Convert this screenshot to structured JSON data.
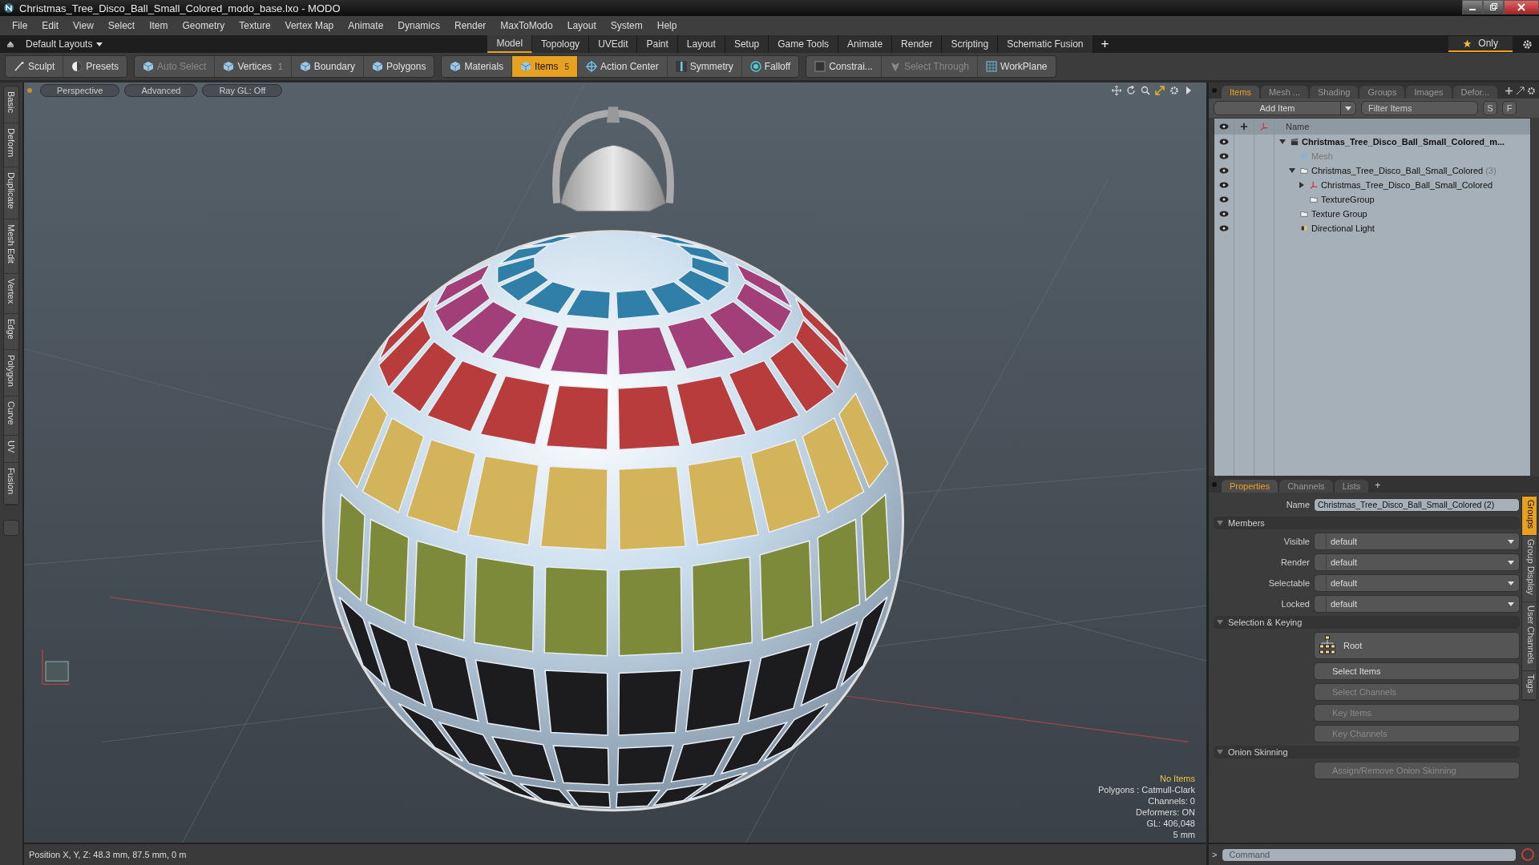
{
  "window": {
    "title": "Christmas_Tree_Disco_Ball_Small_Colored_modo_base.lxo - MODO"
  },
  "menu": [
    "File",
    "Edit",
    "View",
    "Select",
    "Item",
    "Geometry",
    "Texture",
    "Vertex Map",
    "Animate",
    "Dynamics",
    "Render",
    "MaxToModo",
    "Layout",
    "System",
    "Help"
  ],
  "layout_bar": {
    "layouts": "Default Layouts",
    "tabs": [
      {
        "label": "Model",
        "selected": true
      },
      {
        "label": "Topology",
        "selected": false
      },
      {
        "label": "UVEdit",
        "selected": false
      },
      {
        "label": "Paint",
        "selected": false
      },
      {
        "label": "Layout",
        "selected": false
      },
      {
        "label": "Setup",
        "selected": false
      },
      {
        "label": "Game Tools",
        "selected": false
      },
      {
        "label": "Animate",
        "selected": false
      },
      {
        "label": "Render",
        "selected": false
      },
      {
        "label": "Scripting",
        "selected": false
      },
      {
        "label": "Schematic Fusion",
        "selected": false
      }
    ],
    "add": "+",
    "only": "Only"
  },
  "toolbar": {
    "groups": [
      [
        {
          "label": "Sculpt",
          "selected": false,
          "disabled": false
        },
        {
          "label": "Presets",
          "selected": false,
          "disabled": false
        }
      ],
      [
        {
          "label": "Auto Select",
          "selected": false,
          "disabled": true
        },
        {
          "label": "Vertices",
          "selected": false,
          "disabled": false,
          "badge": "1"
        },
        {
          "label": "Boundary",
          "selected": false,
          "disabled": false
        },
        {
          "label": "Polygons",
          "selected": false,
          "disabled": false
        }
      ],
      [
        {
          "label": "Materials",
          "selected": false,
          "disabled": false
        },
        {
          "label": "Items",
          "selected": true,
          "disabled": false,
          "badge": "5"
        },
        {
          "label": "Action Center",
          "selected": false,
          "disabled": false
        },
        {
          "label": "Symmetry",
          "selected": false,
          "disabled": false
        },
        {
          "label": "Falloff",
          "selected": false,
          "disabled": false
        }
      ],
      [
        {
          "label": "Constrai...",
          "selected": false,
          "disabled": false
        },
        {
          "label": "Select Through",
          "selected": false,
          "disabled": true
        },
        {
          "label": "WorkPlane",
          "selected": false,
          "disabled": false
        }
      ]
    ]
  },
  "left_tabs": [
    "Basic",
    "Deform",
    "Duplicate",
    "Mesh Edit",
    "Vertex",
    "Edge",
    "Polygon",
    "Curve",
    "UV",
    "Fusion"
  ],
  "viewport": {
    "tabs": [
      "Perspective",
      "Advanced",
      "Ray GL: Off"
    ],
    "info_title": "No Items",
    "info_lines": [
      "Polygons : Catmull-Clark",
      "Channels: 0",
      "Deformers: ON",
      "GL: 406,048",
      "5 mm"
    ]
  },
  "status_bar": "Position X, Y, Z:  48.3 mm, 87.5 mm, 0 m",
  "items_panel": {
    "tabs": [
      {
        "label": "Items",
        "selected": true
      },
      {
        "label": "Mesh ...",
        "selected": false
      },
      {
        "label": "Shading",
        "selected": false
      },
      {
        "label": "Groups",
        "selected": false
      },
      {
        "label": "Images",
        "selected": false
      },
      {
        "label": "Defor...",
        "selected": false
      }
    ],
    "add_item": "Add Item",
    "filter_placeholder": "Filter Items",
    "filter_buttons": [
      "S",
      "F"
    ],
    "name_column": "Name",
    "tree": [
      {
        "label": "Christmas_Tree_Disco_Ball_Small_Colored_m...",
        "kind": "scene",
        "expanded": true,
        "children": [
          {
            "label": "Mesh",
            "kind": "mesh",
            "disabled": true
          },
          {
            "label": "Christmas_Tree_Disco_Ball_Small_Colored",
            "count": "(3)",
            "kind": "group",
            "expanded": true,
            "children": [
              {
                "label": "Christmas_Tree_Disco_Ball_Small_Colored",
                "kind": "locator",
                "expanded": false
              },
              {
                "label": "TextureGroup",
                "kind": "group"
              }
            ]
          },
          {
            "label": "Texture Group",
            "kind": "group"
          },
          {
            "label": "Directional Light",
            "kind": "light"
          }
        ]
      }
    ]
  },
  "properties": {
    "tabs": [
      {
        "label": "Properties",
        "selected": true
      },
      {
        "label": "Channels",
        "selected": false
      },
      {
        "label": "Lists",
        "selected": false
      }
    ],
    "add": "+",
    "name_label": "Name",
    "name_value": "Christmas_Tree_Disco_Ball_Small_Colored (2)",
    "sections": [
      {
        "title": "Members",
        "rows": [
          {
            "kind": "dropdown",
            "label": "Visible",
            "value": "default"
          },
          {
            "kind": "dropdown",
            "label": "Render",
            "value": "default"
          },
          {
            "kind": "dropdown",
            "label": "Selectable",
            "value": "default"
          },
          {
            "kind": "dropdown",
            "label": "Locked",
            "value": "default"
          }
        ]
      },
      {
        "title": "Selection & Keying",
        "rows": [
          {
            "kind": "root",
            "label": "Root"
          },
          {
            "kind": "button",
            "label": "Select Items",
            "disabled": false
          },
          {
            "kind": "button",
            "label": "Select Channels",
            "disabled": true
          },
          {
            "kind": "button",
            "label": "Key Items",
            "disabled": true
          },
          {
            "kind": "button",
            "label": "Key Channels",
            "disabled": true
          }
        ]
      },
      {
        "title": "Onion Skinning",
        "rows": [
          {
            "kind": "button",
            "label": "Assign/Remove Onion Skinning",
            "disabled": true
          }
        ]
      }
    ],
    "side_tabs": [
      {
        "label": "Groups",
        "selected": true
      },
      {
        "label": "Group Display",
        "selected": false
      },
      {
        "label": "User Channels",
        "selected": false
      },
      {
        "label": "Tags",
        "selected": false
      }
    ]
  },
  "command": {
    "prompt": ">",
    "placeholder": "Command"
  }
}
